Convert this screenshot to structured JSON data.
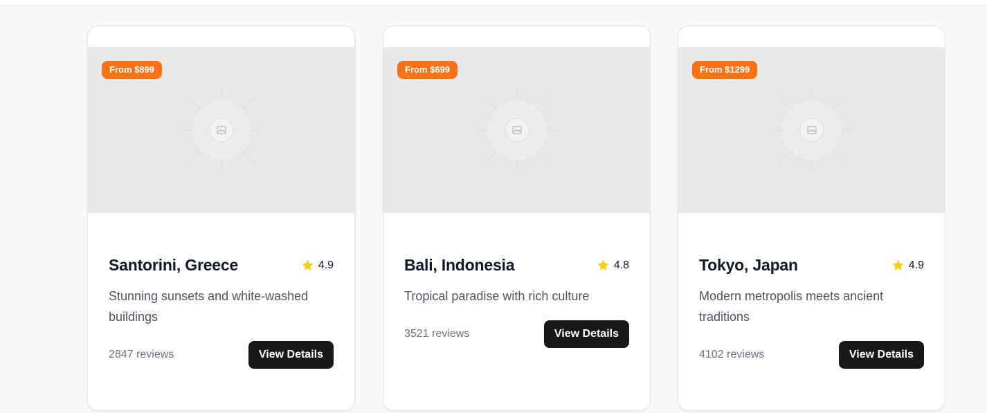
{
  "destinations": [
    {
      "price": "From $899",
      "title": "Santorini, Greece",
      "rating": "4.9",
      "description": "Stunning sunsets and white-washed buildings",
      "reviews": "2847 reviews",
      "button": "View Details"
    },
    {
      "price": "From $699",
      "title": "Bali, Indonesia",
      "rating": "4.8",
      "description": "Tropical paradise with rich culture",
      "reviews": "3521 reviews",
      "button": "View Details"
    },
    {
      "price": "From $1299",
      "title": "Tokyo, Japan",
      "rating": "4.9",
      "description": "Modern metropolis meets ancient traditions",
      "reviews": "4102 reviews",
      "button": "View Details"
    }
  ],
  "colors": {
    "badge": "#f97316",
    "star": "#facc15",
    "button": "#18181b",
    "image_placeholder": "#e9e9e9"
  },
  "icons": {
    "image": "image-placeholder-icon",
    "rating": "star-icon"
  }
}
